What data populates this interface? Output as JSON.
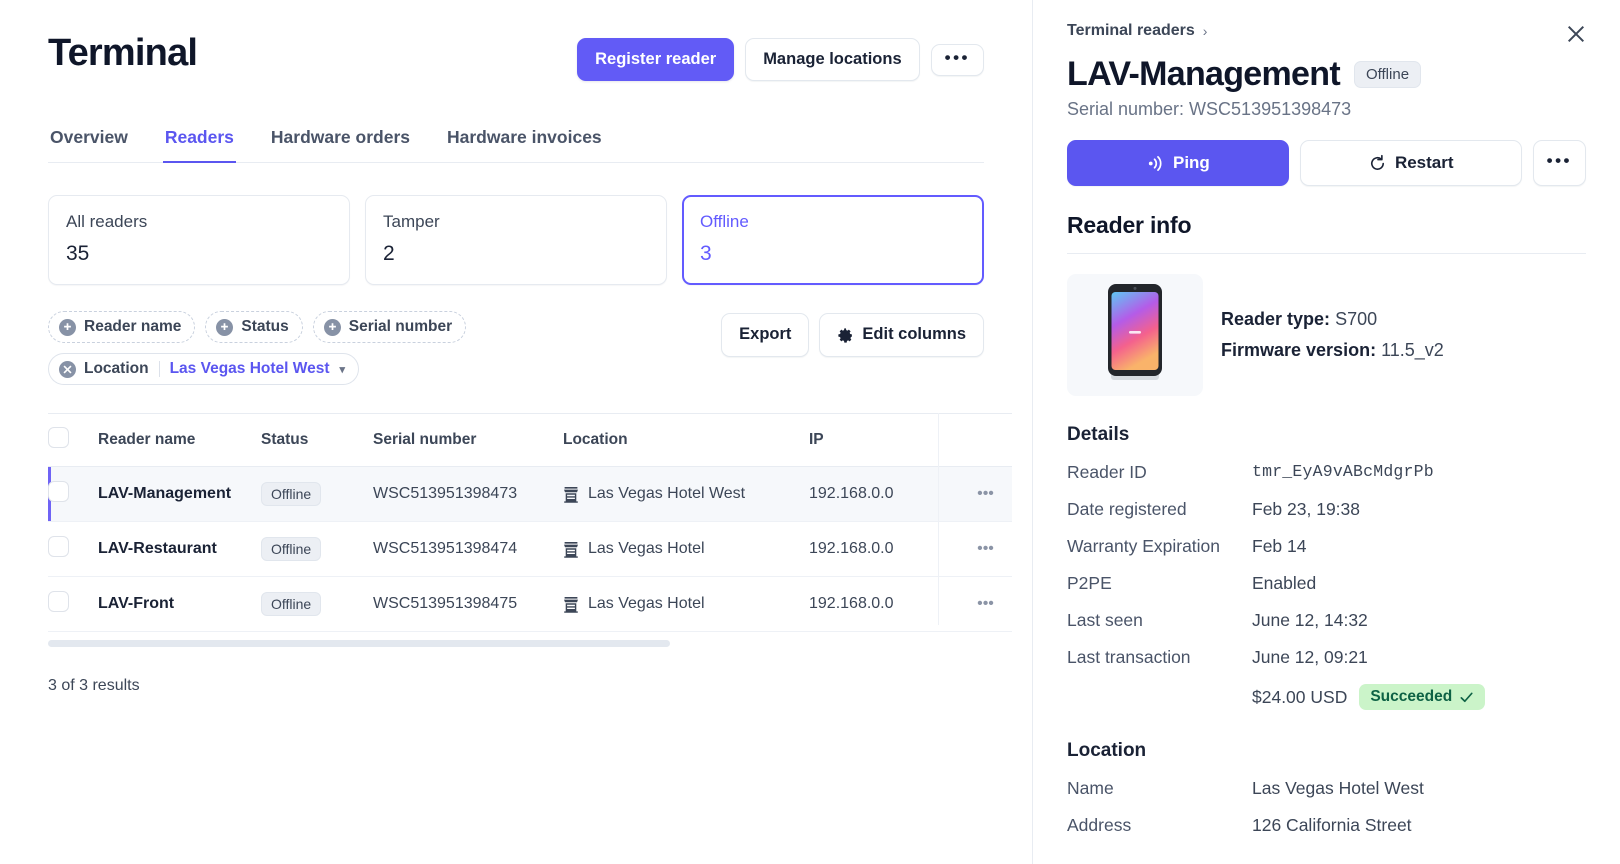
{
  "header": {
    "title": "Terminal",
    "register_label": "Register reader",
    "manage_label": "Manage locations",
    "more_label": "•••"
  },
  "tabs": [
    {
      "label": "Overview",
      "active": false
    },
    {
      "label": "Readers",
      "active": true
    },
    {
      "label": "Hardware orders",
      "active": false
    },
    {
      "label": "Hardware invoices",
      "active": false
    }
  ],
  "stats": [
    {
      "label": "All readers",
      "value": "35",
      "active": false
    },
    {
      "label": "Tamper",
      "value": "2",
      "active": false
    },
    {
      "label": "Offline",
      "value": "3",
      "active": true
    }
  ],
  "filters": {
    "chips": [
      {
        "label": "Reader name"
      },
      {
        "label": "Status"
      },
      {
        "label": "Serial number"
      }
    ],
    "active_chip": {
      "label": "Location",
      "value": "Las Vegas Hotel West"
    },
    "export_label": "Export",
    "edit_columns_label": "Edit columns"
  },
  "table": {
    "columns": [
      "Reader name",
      "Status",
      "Serial number",
      "Location",
      "IP"
    ],
    "rows": [
      {
        "name": "LAV-Management",
        "status": "Offline",
        "serial": "WSC513951398473",
        "location": "Las Vegas Hotel West",
        "ip": "192.168.0.0",
        "selected": true
      },
      {
        "name": "LAV-Restaurant",
        "status": "Offline",
        "serial": "WSC513951398474",
        "location": "Las Vegas Hotel",
        "ip": "192.168.0.0",
        "selected": false
      },
      {
        "name": "LAV-Front",
        "status": "Offline",
        "serial": "WSC513951398475",
        "location": "Las Vegas Hotel",
        "ip": "192.168.0.0",
        "selected": false
      }
    ],
    "row_menu_label": "•••",
    "results": "3 of 3 results"
  },
  "panel": {
    "breadcrumb": "Terminal readers",
    "title": "LAV-Management",
    "status": "Offline",
    "serial_line": "Serial number: WSC513951398473",
    "ping_label": "Ping",
    "restart_label": "Restart",
    "more_label": "•••",
    "reader_info": {
      "heading": "Reader info",
      "type_label": "Reader type:",
      "type_value": "S700",
      "firmware_label": "Firmware version:",
      "firmware_value": "11.5_v2",
      "device_brand": "stripe"
    },
    "details": {
      "heading": "Details",
      "items": [
        {
          "key": "Reader ID",
          "value": "tmr_EyA9vABcMdgrPb",
          "mono": true
        },
        {
          "key": "Date registered",
          "value": "Feb 23, 19:38"
        },
        {
          "key": "Warranty Expiration",
          "value": "Feb 14"
        },
        {
          "key": "P2PE",
          "value": "Enabled"
        },
        {
          "key": "Last seen",
          "value": "June 12, 14:32"
        },
        {
          "key": "Last transaction",
          "value": "June 12, 09:21"
        }
      ],
      "transaction_amount": "$24.00 USD",
      "transaction_status": "Succeeded"
    },
    "location": {
      "heading": "Location",
      "items": [
        {
          "key": "Name",
          "value": "Las Vegas Hotel West"
        },
        {
          "key": "Address",
          "value": "126 California Street"
        }
      ]
    }
  },
  "colors": {
    "accent": "#635bff",
    "accent_button": "#5b56f0",
    "success_bg": "#cbf4c9",
    "success_fg": "#0e6245",
    "text": "#1a2235",
    "muted": "#4a5468"
  }
}
